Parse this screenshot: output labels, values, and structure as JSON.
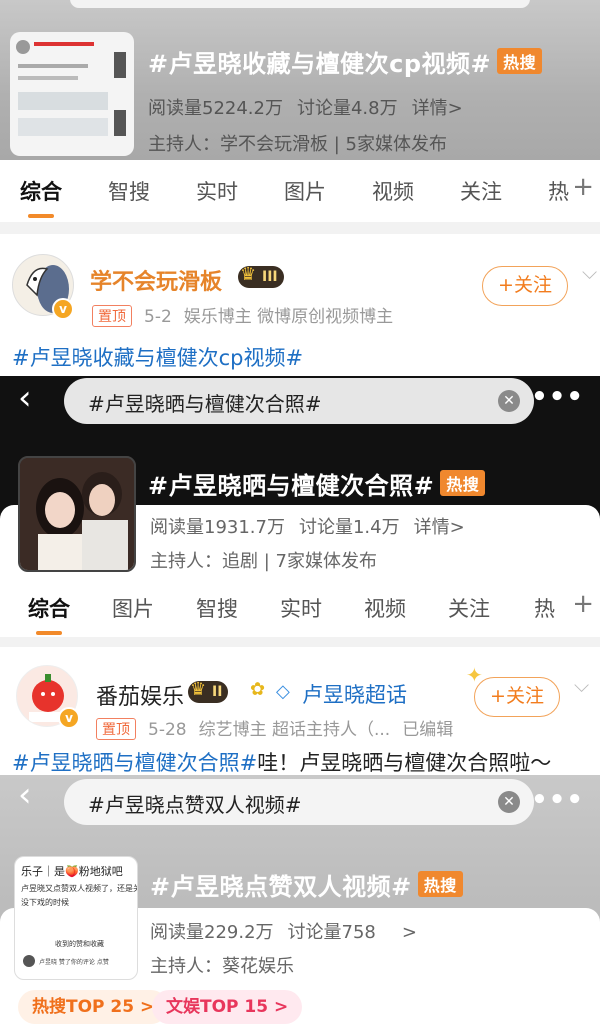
{
  "topic1": {
    "title": "#卢昱晓收藏与檀健次cp视频#",
    "hot_badge": "热搜",
    "reads": "阅读量5224.2万",
    "discussions": "讨论量4.8万",
    "details": "详情>",
    "host": "主持人：学不会玩滑板 | 5家媒体发布",
    "tabs": [
      "综合",
      "智搜",
      "实时",
      "图片",
      "视频",
      "关注",
      "热"
    ]
  },
  "post1": {
    "user": "学不会玩滑板",
    "level": "III",
    "follow": "+关注",
    "pin": "置顶",
    "date": "5-2",
    "tags": "娱乐博主 微博原创视频博主",
    "text": "#卢昱晓收藏与檀健次cp视频#"
  },
  "search2": {
    "query": "#卢昱晓晒与檀健次合照#"
  },
  "topic2": {
    "title": "#卢昱晓晒与檀健次合照#",
    "hot_badge": "热搜",
    "reads": "阅读量1931.7万",
    "discussions": "讨论量1.4万",
    "details": "详情>",
    "host": "主持人：追剧 | 7家媒体发布",
    "tabs": [
      "综合",
      "图片",
      "智搜",
      "实时",
      "视频",
      "关注",
      "热"
    ]
  },
  "post2": {
    "user": "番茄娱乐",
    "level": "II",
    "super_topic": "卢昱晓超话",
    "follow": "+关注",
    "pin": "置顶",
    "date": "5-28",
    "tags": "综艺博主 超话主持人（...",
    "edited": "已编辑",
    "text_tag": "#卢昱晓晒与檀健次合照#",
    "text_rest": "哇！卢昱晓晒与檀健次合照啦～"
  },
  "search3": {
    "query": "#卢昱晓点赞双人视频#"
  },
  "topic3": {
    "title": "#卢昱晓点赞双人视频#",
    "hot_badge": "热搜",
    "reads": "阅读量229.2万",
    "discussions": "讨论量758",
    "more": ">",
    "host": "主持人：葵花娱乐",
    "hot_rank": "热搜TOP 25 >",
    "ent_rank": "文娱TOP 15 >",
    "thumb_lines": [
      "乐子｜是🍑粉地狱吧",
      "卢昱晓又点赞双人视频了，还是关",
      "没下戏的时候",
      "收到的赞和收藏",
      "卢昱晓 赞了你的评论 点赞"
    ]
  },
  "colors": {
    "accent": "#f28a2a",
    "link": "#1e6fc4",
    "hot": "#f0882e"
  }
}
